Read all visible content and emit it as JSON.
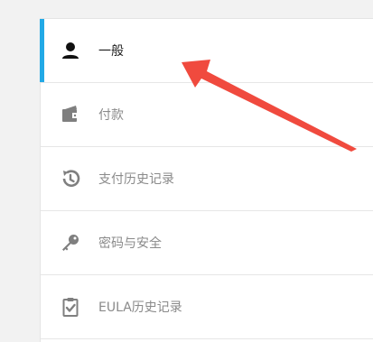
{
  "sidebar": {
    "items": [
      {
        "label": "一般",
        "icon": "user-icon",
        "active": true
      },
      {
        "label": "付款",
        "icon": "wallet-icon",
        "active": false
      },
      {
        "label": "支付历史记录",
        "icon": "history-icon",
        "active": false
      },
      {
        "label": "密码与安全",
        "icon": "key-icon",
        "active": false
      },
      {
        "label": "EULA历史记录",
        "icon": "clipboard-check-icon",
        "active": false
      }
    ]
  },
  "colors": {
    "accent": "#22a9e6",
    "annotation_arrow": "#f04a3e",
    "active_text": "#1e1e1e",
    "inactive_text": "#8a8a8a",
    "inactive_icon": "#7f7f7f"
  }
}
